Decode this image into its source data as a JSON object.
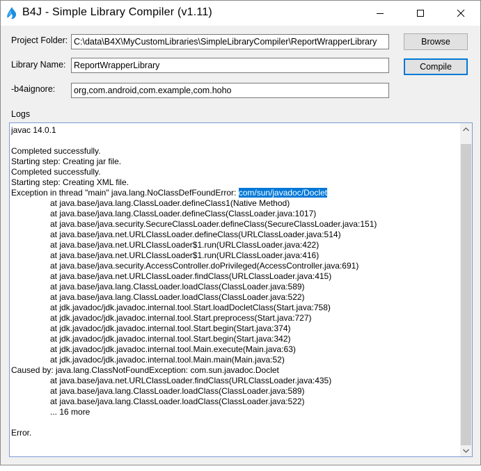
{
  "window": {
    "title": "B4J - Simple Library Compiler (v1.11)"
  },
  "form": {
    "project_folder_label": "Project Folder:",
    "project_folder_value": "C:\\data\\B4X\\MyCustomLibraries\\SimpleLibraryCompiler\\ReportWrapperLibrary",
    "library_name_label": "Library Name:",
    "library_name_value": "ReportWrapperLibrary",
    "ignore_label": "-b4aignore:",
    "ignore_value": "org,com.android,com.example,com.hoho",
    "browse_label": "Browse",
    "compile_label": "Compile"
  },
  "logs": {
    "label": "Logs",
    "lines": [
      "javac 14.0.1",
      "",
      "Completed successfully.",
      "Starting step: Creating jar file.",
      "Completed successfully.",
      "Starting step: Creating XML file.",
      "Exception in thread \"main\" java.lang.NoClassDefFoundError: ",
      "at java.base/java.lang.ClassLoader.defineClass1(Native Method)",
      "at java.base/java.lang.ClassLoader.defineClass(ClassLoader.java:1017)",
      "at java.base/java.security.SecureClassLoader.defineClass(SecureClassLoader.java:151)",
      "at java.base/java.net.URLClassLoader.defineClass(URLClassLoader.java:514)",
      "at java.base/java.net.URLClassLoader$1.run(URLClassLoader.java:422)",
      "at java.base/java.net.URLClassLoader$1.run(URLClassLoader.java:416)",
      "at java.base/java.security.AccessController.doPrivileged(AccessController.java:691)",
      "at java.base/java.net.URLClassLoader.findClass(URLClassLoader.java:415)",
      "at java.base/java.lang.ClassLoader.loadClass(ClassLoader.java:589)",
      "at java.base/java.lang.ClassLoader.loadClass(ClassLoader.java:522)",
      "at jdk.javadoc/jdk.javadoc.internal.tool.Start.loadDocletClass(Start.java:758)",
      "at jdk.javadoc/jdk.javadoc.internal.tool.Start.preprocess(Start.java:727)",
      "at jdk.javadoc/jdk.javadoc.internal.tool.Start.begin(Start.java:374)",
      "at jdk.javadoc/jdk.javadoc.internal.tool.Start.begin(Start.java:342)",
      "at jdk.javadoc/jdk.javadoc.internal.tool.Main.execute(Main.java:63)",
      "at jdk.javadoc/jdk.javadoc.internal.tool.Main.main(Main.java:52)",
      "Caused by: java.lang.ClassNotFoundException: com.sun.javadoc.Doclet",
      "at java.base/java.net.URLClassLoader.findClass(URLClassLoader.java:435)",
      "at java.base/java.lang.ClassLoader.loadClass(ClassLoader.java:589)",
      "at java.base/java.lang.ClassLoader.loadClass(ClassLoader.java:522)",
      "... 16 more",
      "",
      "Error."
    ],
    "selected_text": "com/sun/javadoc/Doclet"
  },
  "icons": {
    "app": "b4j-logo-icon",
    "minimize": "minimize-icon",
    "maximize": "maximize-icon",
    "close": "close-icon",
    "scroll_up": "chevron-up-icon",
    "scroll_down": "chevron-down-icon"
  },
  "colors": {
    "selection": "#0078d7",
    "default_button_border": "#0078d7",
    "scrollbar_thumb": "#cdcdcd"
  }
}
